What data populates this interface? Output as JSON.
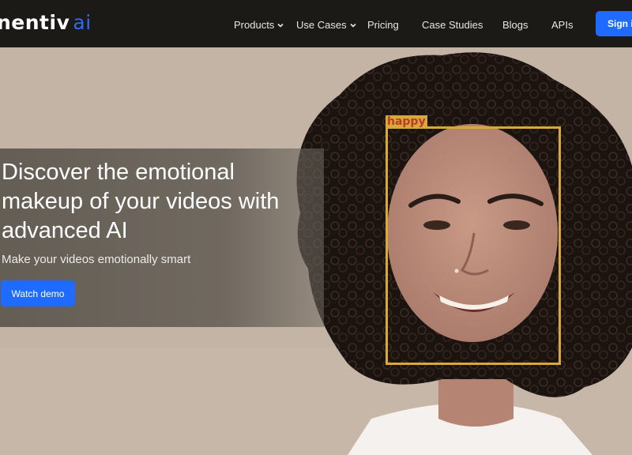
{
  "brand": {
    "name": "nentiv",
    "suffix": "ai",
    "accent": "#1f6bff"
  },
  "nav": {
    "items": [
      {
        "label": "Products",
        "dropdown": true
      },
      {
        "label": "Use Cases",
        "dropdown": true
      },
      {
        "label": "Pricing",
        "dropdown": false
      },
      {
        "label": "Case Studies",
        "dropdown": false
      },
      {
        "label": "Blogs",
        "dropdown": false
      },
      {
        "label": "APIs",
        "dropdown": false
      }
    ],
    "signin_label": "Sign in"
  },
  "hero": {
    "headline": "Discover the emotional makeup of your videos with advanced AI",
    "subheadline": "Make your videos emotionally smart",
    "cta_label": "Watch demo",
    "detection": {
      "label": "happy",
      "box_color": "#d7a93a"
    }
  }
}
